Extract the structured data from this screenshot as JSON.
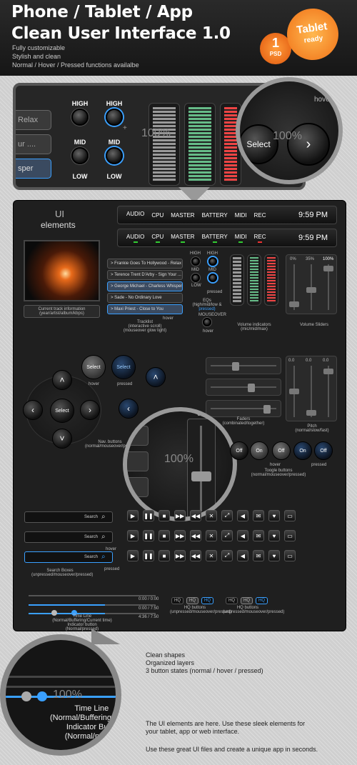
{
  "header": {
    "title1": "Phone / Tablet / App",
    "title2": "Clean User Interface 1.0",
    "sub1": "Fully customizable",
    "sub2": "Stylish and clean",
    "sub3": "Normal / Hover / Pressed functions availalbe",
    "psd_num": "1",
    "psd_label": "PSD",
    "tablet": "Tablet",
    "ready": "ready"
  },
  "zoom_top": {
    "tabs": [
      "Relax",
      "ur ....",
      "sper"
    ],
    "knobs": [
      {
        "label": "HIGH"
      },
      {
        "label": "HIGH"
      },
      {
        "label": "MID"
      },
      {
        "label": "MID"
      },
      {
        "label": "LOW"
      },
      {
        "label": "LOW"
      }
    ],
    "plus": "+",
    "minus": "−",
    "pct": "100%",
    "select": "Select",
    "hover": "hover",
    "pct2": "100%"
  },
  "panel": {
    "ui": "UI",
    "elements": "elements",
    "strip_labels": [
      "AUDIO",
      "CPU",
      "MASTER",
      "BATTERY",
      "MIDI",
      "REC"
    ],
    "time": "9:59 PM",
    "video_caption": "Current track information",
    "video_caption2": "(year/artist/album/kbps)",
    "tracks": [
      "> Frankie Goes To Hollywood - Relax",
      "> Terence Trent D'Arby - Sign Your ...",
      "> George Michael - Charless Whisper",
      "> Sade - No Ordinary Love",
      "> Maxi Priest - Close to You"
    ],
    "tracklist": "Tracklist",
    "tracklist2": "(interactive scroll)",
    "tracklist3": "(mouseover glow light)",
    "hover": "hover",
    "eq_high": "HIGH",
    "eq_mid": "MID",
    "eq_low": "LOW",
    "eq_pressed": "pressed",
    "eqs": "EQs",
    "eqs2": "(high/mid/low &",
    "eqs_pressed": "pressed)",
    "mouseover": "MOUSEOVER",
    "vol_ind": "Volume indicators",
    "vol_ind2": "(mic/mid/max)",
    "vs_pct": [
      "0%",
      "35%",
      "100%"
    ],
    "vol_sliders": "Volume Sliders",
    "select": "Select",
    "pressed": "pressed",
    "nav": "Nav. buttons",
    "nav2": "(normal/mouseover/press)",
    "faders": "Faders",
    "faders2": "(combinated/together)",
    "pitch_vals": [
      "0.0",
      "0.0",
      "0.0"
    ],
    "pitch": "Pitch",
    "pitch2": "(normal/slow/fast)",
    "pct": "100%",
    "zoom_val": "0.0",
    "toggles": [
      "Off",
      "On",
      "Off",
      "On",
      "Off"
    ],
    "toggle_lbl": "Toogle buttons",
    "toggle_lbl2": "(normal/mouseover/pressed)",
    "search": "Search",
    "search_boxes": "Search Boxes",
    "search_boxes2": "(unpressed/mouseover/pressed)",
    "times": [
      "0:00 / 0:00",
      "0:00 / 7:50",
      "4:36 / 7:50"
    ],
    "timeline": "Time Line",
    "timeline2": "(Normal/Buffering/Current time)",
    "indicator": "Indicator button",
    "indicator2": "(Normal/pressed)",
    "hq": "HQ",
    "hq_lbl": "HQ buttons",
    "hq_lbl2": "(unpressed/mouseover/pressed)"
  },
  "bottom": {
    "pct": "100%",
    "timeline": "Time Line",
    "tl2": "(Normal/Buffering/Curre",
    "tl3": "Indicator Butto",
    "tl4": "(Normal/presse",
    "f1": "Clean shapes",
    "f2": "Organized layers",
    "f3": "3 button states (normal / hover / pressed)",
    "p1": "The UI elements are here. Use these sleek elements for",
    "p2": "your tablet, app or web interface.",
    "p3": "Use these great UI files and create a unique app in seconds."
  },
  "colors": {
    "accent": "#3aa0ff",
    "badge": "#f07016"
  }
}
